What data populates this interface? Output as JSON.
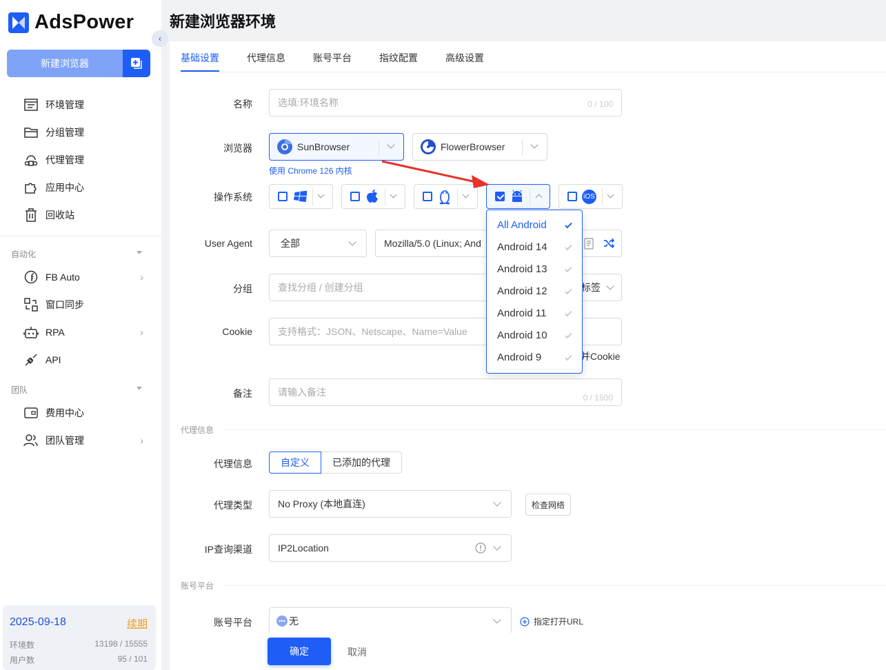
{
  "app": {
    "name": "AdsPower"
  },
  "sidebar": {
    "new_browser_label": "新建浏览器",
    "nav": [
      {
        "label": "环境管理",
        "icon": "browser-list-icon"
      },
      {
        "label": "分组管理",
        "icon": "folder-icon"
      },
      {
        "label": "代理管理",
        "icon": "proxy-icon"
      },
      {
        "label": "应用中心",
        "icon": "puzzle-icon"
      },
      {
        "label": "回收站",
        "icon": "trash-icon"
      }
    ],
    "automation_label": "自动化",
    "automation": [
      {
        "label": "FB Auto",
        "icon": "fb-auto-icon"
      },
      {
        "label": "窗口同步",
        "icon": "window-sync-icon"
      },
      {
        "label": "RPA",
        "icon": "robot-icon"
      },
      {
        "label": "API",
        "icon": "plug-icon"
      }
    ],
    "team_label": "团队",
    "team": [
      {
        "label": "费用中心",
        "icon": "wallet-icon"
      },
      {
        "label": "团队管理",
        "icon": "team-icon"
      }
    ],
    "account": {
      "expire_date": "2025-09-18",
      "renew_label": "续期",
      "env_label": "环境数",
      "env_value": "13198 / 15555",
      "user_label": "用户数",
      "user_value": "95 / 101"
    }
  },
  "page": {
    "title": "新建浏览器环境",
    "tabs": [
      "基础设置",
      "代理信息",
      "账号平台",
      "指纹配置",
      "高级设置"
    ]
  },
  "form": {
    "name_label": "名称",
    "name_placeholder": "选填:环境名称",
    "name_count": "0 / 100",
    "browser_label": "浏览器",
    "browser_options": [
      "SunBrowser",
      "FlowerBrowser"
    ],
    "browser_hint": "使用 Chrome 126 内核",
    "os_label": "操作系统",
    "os_icons": [
      "windows-icon",
      "apple-icon",
      "linux-icon",
      "android-icon",
      "ios-icon"
    ],
    "ua_label": "User Agent",
    "ua_scope": "全部",
    "ua_value": "Mozilla/5.0 (Linux; And",
    "group_label": "分组",
    "group_placeholder": "查找分组 / 创建分组",
    "tag_label": "标签",
    "cookie_label": "Cookie",
    "cookie_placeholder": "支持格式：JSON、Netscape、Name=Value",
    "cookie_merge": "并Cookie",
    "remark_label": "备注",
    "remark_placeholder": "请输入备注",
    "remark_count": "0 / 1500"
  },
  "android_dropdown": {
    "items": [
      "All Android",
      "Android 14",
      "Android 13",
      "Android 12",
      "Android 11",
      "Android 10",
      "Android 9"
    ],
    "selected": "All Android"
  },
  "proxy": {
    "section_label": "代理信息",
    "info_label": "代理信息",
    "seg_custom": "自定义",
    "seg_added": "已添加的代理",
    "type_label": "代理类型",
    "type_value": "No Proxy (本地直连)",
    "check_network": "检查网络",
    "ip_label": "IP查询渠道",
    "ip_value": "IP2Location"
  },
  "account_platform": {
    "section_label": "账号平台",
    "label": "账号平台",
    "value": "无",
    "open_url": "指定打开URL"
  },
  "footer": {
    "ok": "确定",
    "cancel": "取消"
  },
  "colors": {
    "primary": "#1e5ef6",
    "arrow": "#e8322a",
    "renew": "#f0a020"
  }
}
